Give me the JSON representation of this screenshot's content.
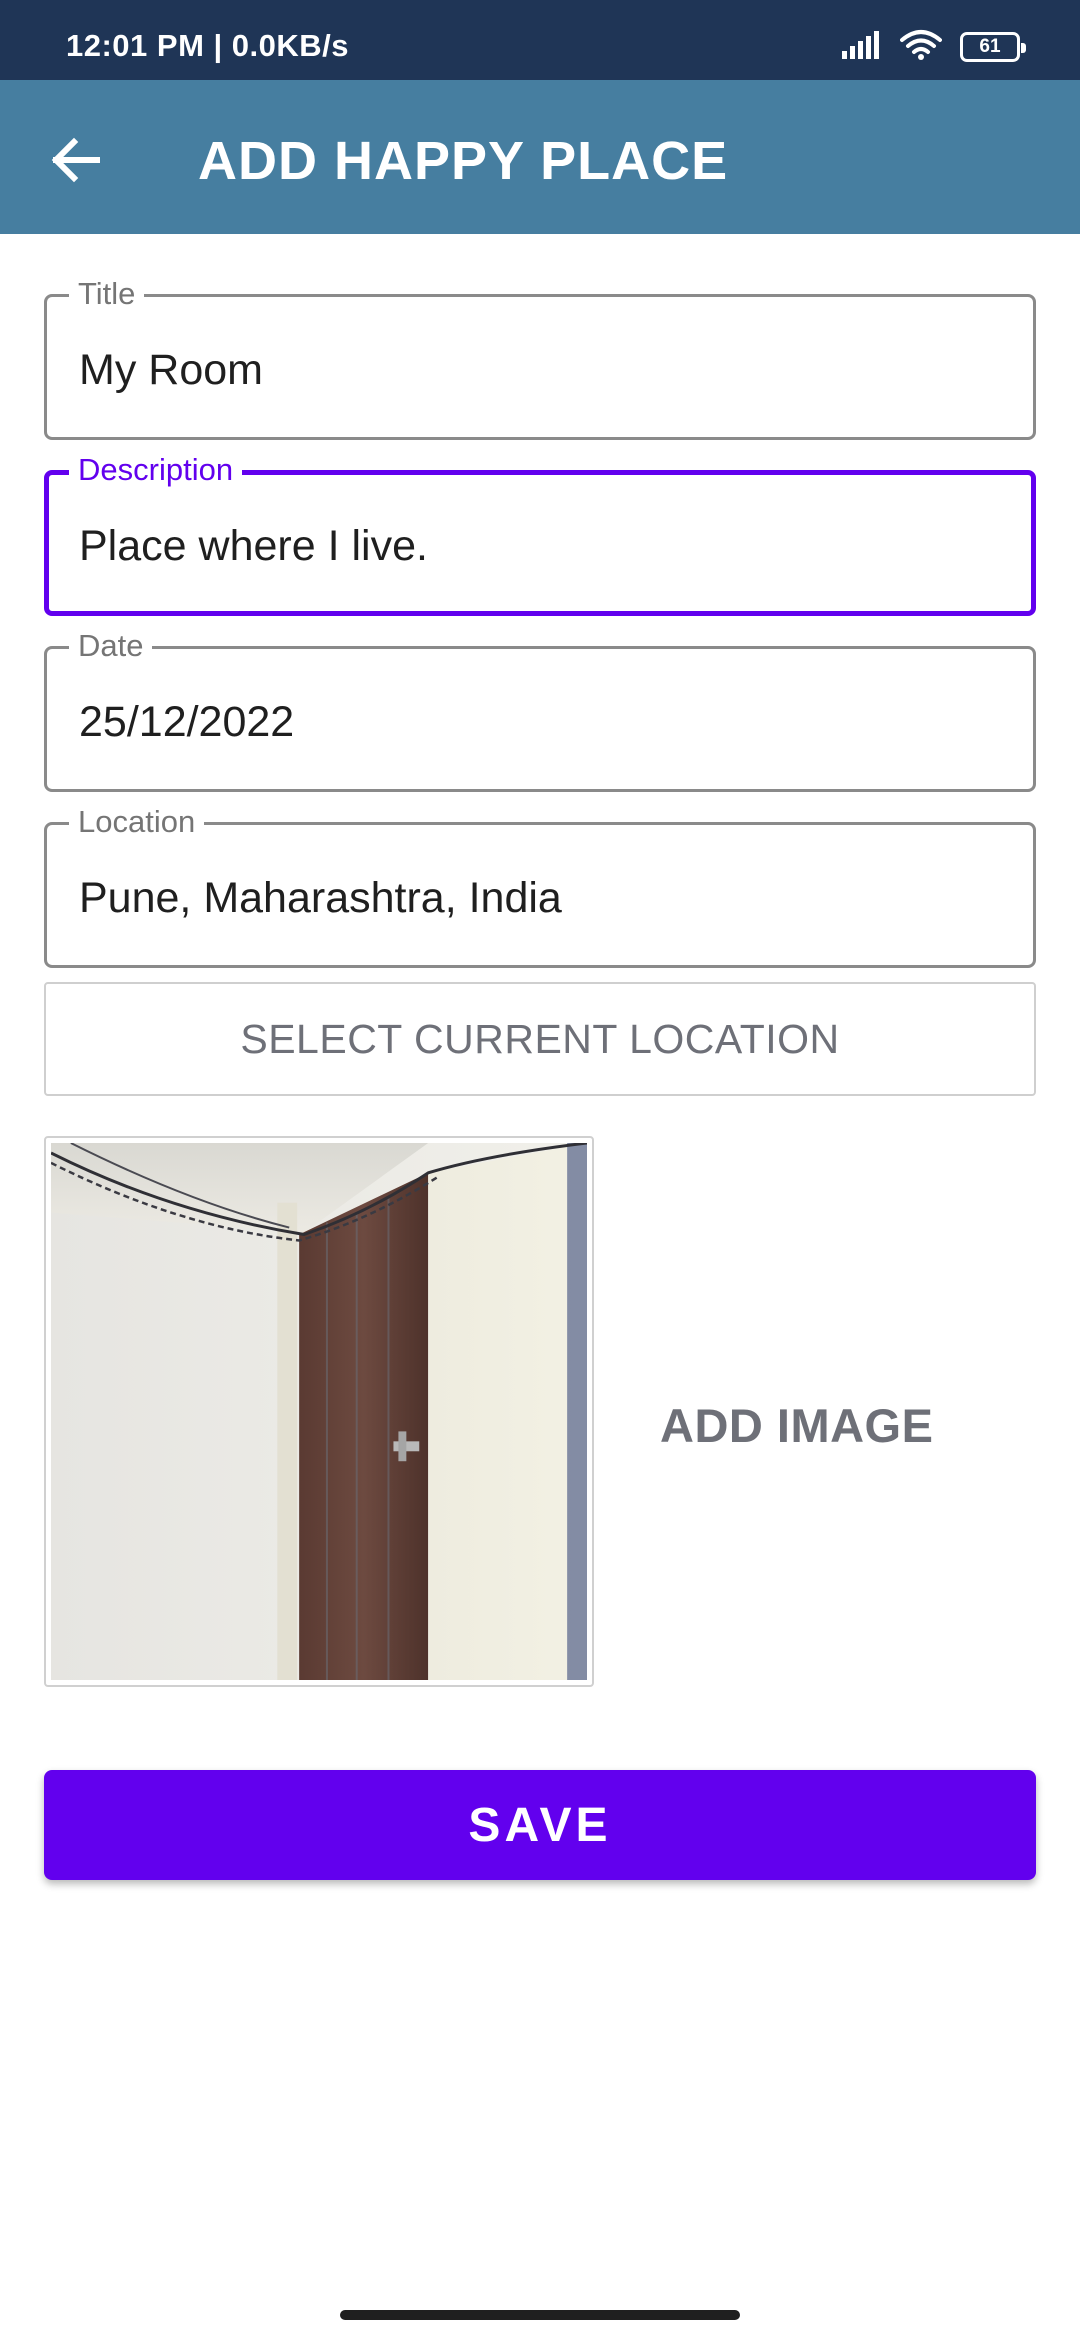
{
  "status_bar": {
    "time": "12:01 PM | 0.0KB/s",
    "battery": "61",
    "icons": [
      "signal-icon",
      "wifi-icon",
      "battery-icon"
    ]
  },
  "app_bar": {
    "title": "ADD HAPPY PLACE",
    "back_icon": "arrow-back-icon"
  },
  "form": {
    "title": {
      "label": "Title",
      "value": "My Room"
    },
    "description": {
      "label": "Description",
      "value": "Place where I live."
    },
    "date": {
      "label": "Date",
      "value": "25/12/2022"
    },
    "location": {
      "label": "Location",
      "value": "Pune, Maharashtra, India"
    }
  },
  "select_location_label": "SELECT CURRENT LOCATION",
  "add_image_label": "ADD IMAGE",
  "save_label": "SAVE",
  "colors": {
    "status_bar": "#1f3556",
    "app_bar": "#467ea0",
    "accent": "#6200ee",
    "muted_text": "#6e7078"
  }
}
